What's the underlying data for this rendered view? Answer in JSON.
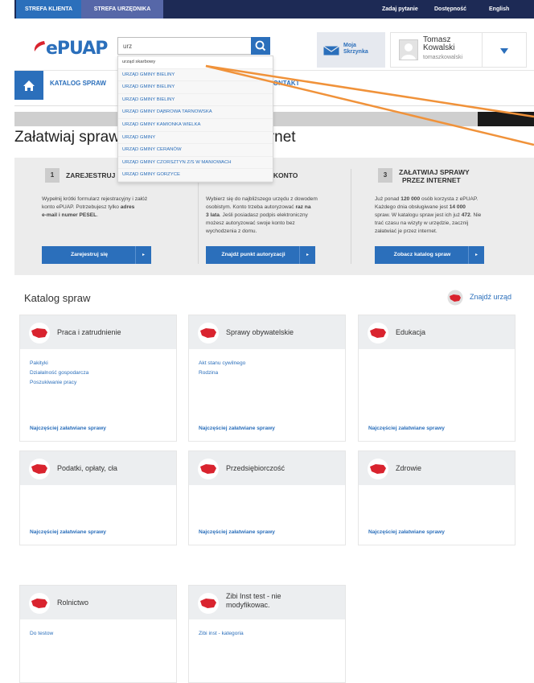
{
  "topbar": {
    "tab_klient": "STREFA KLIENTA",
    "tab_urzednik": "STREFA URZĘDNIKA",
    "ask": "Zadaj pytanie",
    "accessibility": "Dostępność",
    "language": "English"
  },
  "header": {
    "logo": "ePUAP",
    "search_value": "urz",
    "mailbox_label_1": "Moja",
    "mailbox_label_2": "Skrzynka",
    "user_first": "Tomasz",
    "user_last": "Kowalski",
    "user_login": "tomaszkowalski"
  },
  "nav": {
    "catalog": "KATALOG SPRAW",
    "contact": "KONTAKT"
  },
  "page_title": "Załatwiaj sprawy urzędowe przez Internet",
  "steps": [
    {
      "num": "1",
      "title": "ZAREJESTRUJ SIĘ",
      "desc_1": "Wypełnij krótki formularz rejestracyjny i załóż",
      "desc_2": "konto ePUAP. Potrzebujesz tylko",
      "desc_bold_1": "adres",
      "desc_bold_2": "e-mail i numer PESEL",
      "button": "Zarejestruj się"
    },
    {
      "num": "2",
      "title": "AUTORYZUJ KONTO",
      "desc_1": "Wybierz się do najbliższego urzędu z dowodem",
      "desc_2": "osobistym. Konto trzeba autoryzować",
      "desc_bold_1": "raz na",
      "desc_bold_2": "3 lata",
      "desc_3": ". Jeśli posiadasz podpis elektroniczny",
      "desc_4": "możesz autoryzować swoje konto bez",
      "desc_5": "wychodzenia z domu.",
      "button": "Znajdź punkt autoryzacji"
    },
    {
      "num": "3",
      "title_1": "ZAŁATWIAJ SPRAWY",
      "title_2": "PRZEZ INTERNET",
      "desc_1": "Już ponad",
      "desc_bold_1": "120 000",
      "desc_2": "osób korzysta z ePUAP.",
      "desc_3": "Każdego dnia obsługiwane jest",
      "desc_bold_2": "14 000",
      "desc_4": "spraw. W katalogu spraw jest ich już",
      "desc_bold_3": "472",
      "desc_5": ". Nie",
      "desc_6": "trać czasu na wizyty w urzędzie, zacznij",
      "desc_7": "załatwiać je przez internet.",
      "button": "Zobacz katalog spraw"
    }
  ],
  "catalog": {
    "title": "Katalog spraw",
    "find_office": "Znajdź urząd",
    "freq_label": "Najczęściej załatwiane sprawy",
    "cards": [
      {
        "title": "Praca i zatrudnienie",
        "links": [
          "Pakityki",
          "Działalność gospodarcza",
          "Poszukiwanie pracy"
        ]
      },
      {
        "title": "Sprawy obywatelskie",
        "links": [
          "Akt stanu cywilnego",
          "Rodzina"
        ]
      },
      {
        "title": "Edukacja",
        "links": []
      },
      {
        "title": "Podatki, opłaty, cła",
        "links": []
      },
      {
        "title": "Przedsiębiorczość",
        "links": []
      },
      {
        "title": "Zdrowie",
        "links": []
      },
      {
        "title": "Rolnictwo",
        "links": [
          "Do testow"
        ]
      },
      {
        "title_1": "Zibi Inst test - nie",
        "title_2": "modyfikowac.",
        "links": [
          "Zibi inst - kategoria"
        ]
      }
    ]
  },
  "dropdown": {
    "options": [
      "urząd skarbowy",
      "URZĄD GMINY BIELINY",
      "URZĄD GMINY BIELINY",
      "URZĄD GMINY BIELINY",
      "URZĄD GMINY DĄBROWA TARNOWSKA",
      "URZĄD GMINY KAMIONKA WIELKA",
      "URZĄD GMINY",
      "URZĄD GMINY CERANÓW",
      "URZĄD GMINY CZORSZTYN Z/S W MANIOWACH",
      "URZĄD GMINY GORZYCE"
    ]
  },
  "colors": {
    "primary": "#2b6fbb",
    "topbar": "#1d2a55",
    "flag_red": "#d9232e",
    "annotation": "#f0923a"
  }
}
